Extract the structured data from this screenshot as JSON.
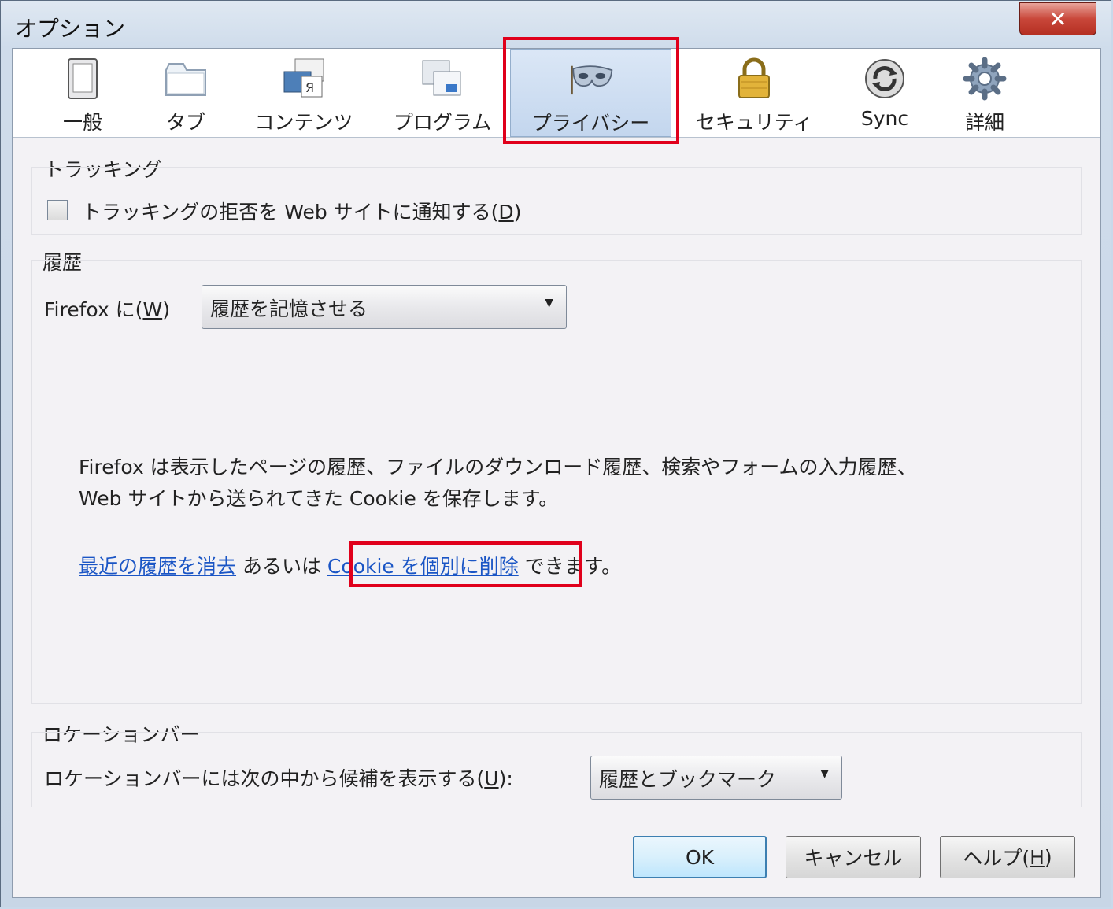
{
  "window": {
    "title": "オプション",
    "close_glyph": "✕"
  },
  "tabs": [
    {
      "label": "一般",
      "icon": "general-icon"
    },
    {
      "label": "タブ",
      "icon": "tabs-icon"
    },
    {
      "label": "コンテンツ",
      "icon": "content-icon"
    },
    {
      "label": "プログラム",
      "icon": "applications-icon"
    },
    {
      "label": "プライバシー",
      "icon": "privacy-mask-icon",
      "selected": true
    },
    {
      "label": "セキュリティ",
      "icon": "padlock-icon"
    },
    {
      "label": "Sync",
      "icon": "sync-icon"
    },
    {
      "label": "詳細",
      "icon": "gear-icon"
    }
  ],
  "tracking": {
    "title": "トラッキング",
    "checkbox_label": "トラッキングの拒否を Web サイトに通知する(",
    "accesskey": "D",
    "checkbox_suffix": ")",
    "checked": false
  },
  "history": {
    "title": "履歴",
    "firefox_label": "Firefox に(",
    "firefox_accesskey": "W",
    "firefox_suffix": ")",
    "mode_value": "履歴を記憶させる",
    "description_line1": "Firefox は表示したページの履歴、ファイルのダウンロード履歴、検索やフォームの入力履歴、",
    "description_line2": "Web サイトから送られてきた Cookie を保存します。",
    "clear_link": "最近の履歴を消去",
    "or_text": " あるいは ",
    "cookie_link": "Cookie を個別に削除",
    "can_text": " できます。"
  },
  "location_bar": {
    "title": "ロケーションバー",
    "suggest_label": "ロケーションバーには次の中から候補を表示する(",
    "suggest_accesskey": "U",
    "suggest_suffix": "):",
    "suggest_value": "履歴とブックマーク"
  },
  "buttons": {
    "ok": "OK",
    "cancel": "キャンセル",
    "help_prefix": "ヘルプ(",
    "help_accesskey": "H",
    "help_suffix": ")"
  },
  "colors": {
    "highlight": "#e0001b",
    "link": "#1a55c5",
    "selected_tab": "#c3d6ee"
  }
}
